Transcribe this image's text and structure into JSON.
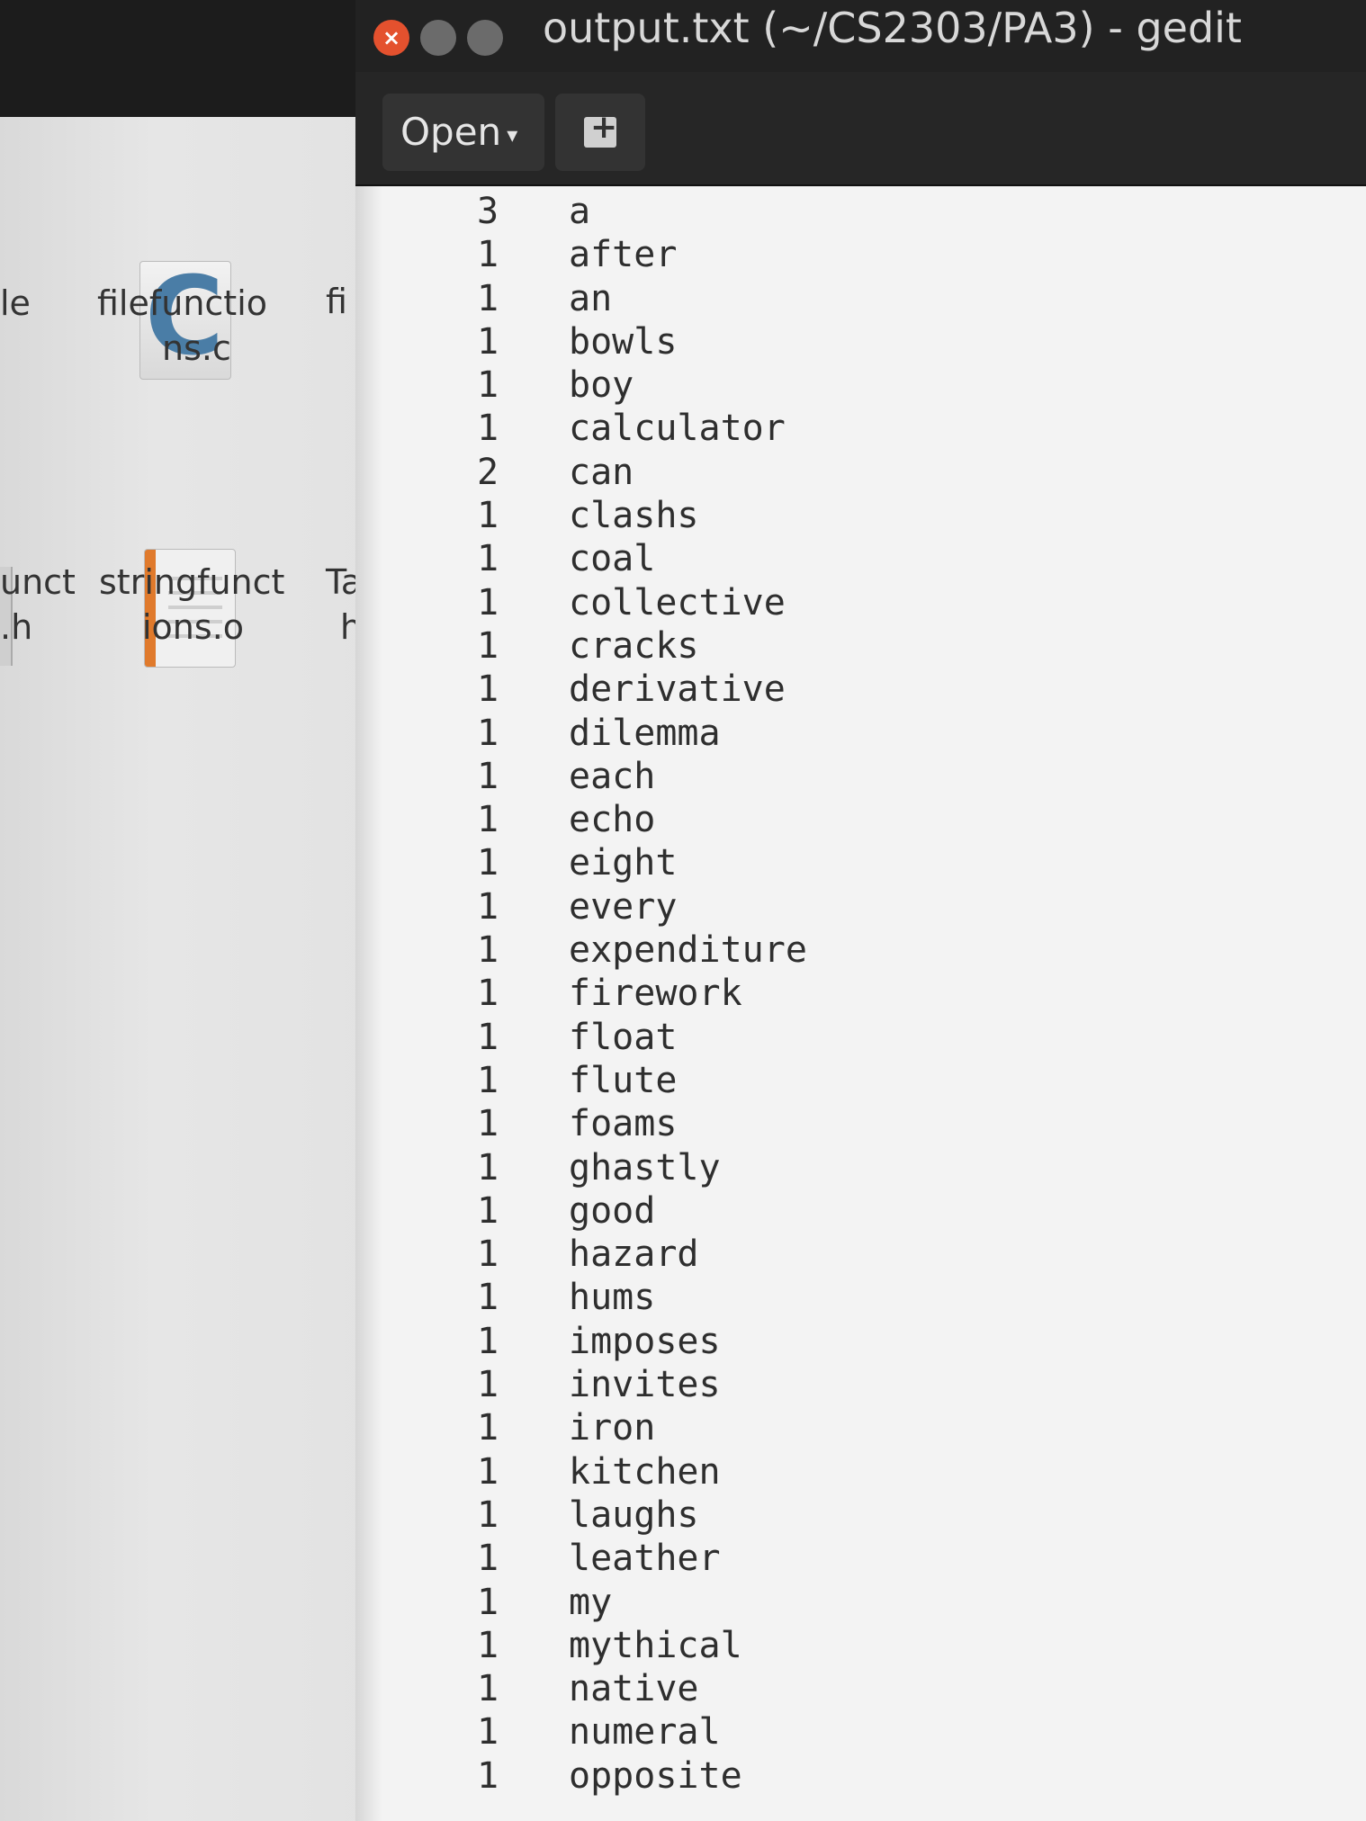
{
  "window": {
    "title": "output.txt (~/CS2303/PA3) - gedit",
    "close_glyph": "×"
  },
  "toolbar": {
    "open_label": "Open",
    "open_arrow": "▾"
  },
  "desktop": {
    "files": [
      {
        "name_line1": "filefunctio",
        "name_line2": "ns.c",
        "icon": "c-source-file-icon"
      },
      {
        "name_line1": "stringfunct",
        "name_line2": "ions.o",
        "icon": "object-file-icon"
      }
    ],
    "cut_labels": {
      "top_left": "le",
      "mid_left_1": "unct",
      "mid_left_2": ".h",
      "top_right": "fi",
      "mid_right_1": "Ta",
      "mid_right_2": "h"
    }
  },
  "document": {
    "lines": [
      {
        "count": "3",
        "word": "a"
      },
      {
        "count": "1",
        "word": "after"
      },
      {
        "count": "1",
        "word": "an"
      },
      {
        "count": "1",
        "word": "bowls"
      },
      {
        "count": "1",
        "word": "boy"
      },
      {
        "count": "1",
        "word": "calculator"
      },
      {
        "count": "2",
        "word": "can"
      },
      {
        "count": "1",
        "word": "clashs"
      },
      {
        "count": "1",
        "word": "coal"
      },
      {
        "count": "1",
        "word": "collective"
      },
      {
        "count": "1",
        "word": "cracks"
      },
      {
        "count": "1",
        "word": "derivative"
      },
      {
        "count": "1",
        "word": "dilemma"
      },
      {
        "count": "1",
        "word": "each"
      },
      {
        "count": "1",
        "word": "echo"
      },
      {
        "count": "1",
        "word": "eight"
      },
      {
        "count": "1",
        "word": "every"
      },
      {
        "count": "1",
        "word": "expenditure"
      },
      {
        "count": "1",
        "word": "firework"
      },
      {
        "count": "1",
        "word": "float"
      },
      {
        "count": "1",
        "word": "flute"
      },
      {
        "count": "1",
        "word": "foams"
      },
      {
        "count": "1",
        "word": "ghastly"
      },
      {
        "count": "1",
        "word": "good"
      },
      {
        "count": "1",
        "word": "hazard"
      },
      {
        "count": "1",
        "word": "hums"
      },
      {
        "count": "1",
        "word": "imposes"
      },
      {
        "count": "1",
        "word": "invites"
      },
      {
        "count": "1",
        "word": "iron"
      },
      {
        "count": "1",
        "word": "kitchen"
      },
      {
        "count": "1",
        "word": "laughs"
      },
      {
        "count": "1",
        "word": "leather"
      },
      {
        "count": "1",
        "word": "my"
      },
      {
        "count": "1",
        "word": "mythical"
      },
      {
        "count": "1",
        "word": "native"
      },
      {
        "count": "1",
        "word": "numeral"
      },
      {
        "count": "1",
        "word": "opposite"
      }
    ]
  }
}
